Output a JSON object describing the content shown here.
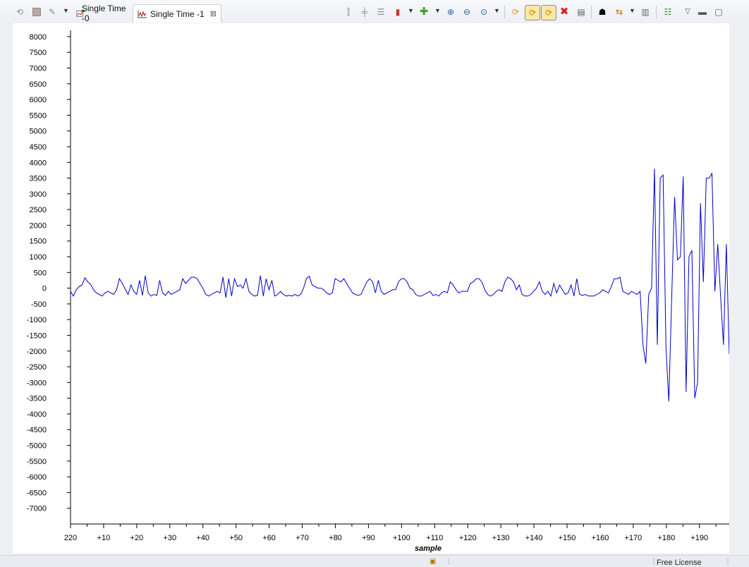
{
  "toolbar": {
    "left_icons": [
      "sync-icon",
      "stop-icon",
      "edit-icon"
    ],
    "right_icons": [
      "align-left-icon",
      "align-center-icon",
      "align-right-icon",
      "marker-icon",
      "add-icon",
      "zoom-in-icon",
      "zoom-out-icon",
      "zoom-fit-icon",
      "refresh-icon",
      "auto-scale-icon",
      "auto-scale-y-icon",
      "remove-icon",
      "export-icon",
      "find-icon",
      "settings-icon",
      "save-icon",
      "properties-icon",
      "view-menu-icon",
      "minimize-icon",
      "maximize-icon"
    ]
  },
  "tabs": [
    {
      "label": "Single Time -0",
      "icon": "graph-edit-icon",
      "active": false
    },
    {
      "label": "Single Time -1",
      "icon": "graph-icon",
      "active": true,
      "close": "⊠"
    }
  ],
  "status": {
    "license": "Free License"
  },
  "chart_data": {
    "type": "line",
    "title": "",
    "xlabel": "sample",
    "ylabel": "",
    "x_tick_labels": [
      "220",
      "+10",
      "+20",
      "+30",
      "+40",
      "+50",
      "+60",
      "+70",
      "+80",
      "+90",
      "+100",
      "+110",
      "+120",
      "+130",
      "+140",
      "+150",
      "+160",
      "+170",
      "+180",
      "+190"
    ],
    "y_tick_labels": [
      "8000",
      "7500",
      "7000",
      "6500",
      "6000",
      "5500",
      "5000",
      "4500",
      "4000",
      "3500",
      "3000",
      "2500",
      "2000",
      "1500",
      "1000",
      "500",
      "0",
      "-500",
      "-1000",
      "-1500",
      "-2000",
      "-2500",
      "-3000",
      "-3500",
      "-4000",
      "-4500",
      "-5000",
      "-5500",
      "-6000",
      "-6500",
      "-7000"
    ],
    "ylim": [
      -7500,
      8200
    ],
    "xlim": [
      0,
      199
    ],
    "grid": false,
    "series": [
      {
        "color": "#0000cc",
        "values": [
          -100,
          -250,
          -50,
          50,
          100,
          330,
          200,
          120,
          -50,
          -150,
          -200,
          -250,
          -150,
          -100,
          -150,
          -200,
          -50,
          300,
          150,
          -30,
          -200,
          100,
          -100,
          -200,
          250,
          -230,
          400,
          -150,
          -250,
          -200,
          -230,
          250,
          -150,
          -230,
          -100,
          -200,
          -150,
          -100,
          -50,
          300,
          150,
          250,
          350,
          350,
          300,
          150,
          0,
          -200,
          -250,
          -200,
          -150,
          -100,
          -150,
          350,
          -300,
          300,
          -250,
          300,
          50,
          100,
          0,
          300,
          -100,
          -200,
          -250,
          -230,
          400,
          -250,
          300,
          -50,
          250,
          -250,
          -200,
          -100,
          -200,
          -250,
          -230,
          -250,
          -200,
          -250,
          -200,
          0,
          300,
          380,
          100,
          50,
          0,
          0,
          -50,
          -150,
          -200,
          -150,
          300,
          250,
          200,
          300,
          150,
          0,
          -150,
          -200,
          -230,
          -200,
          0,
          200,
          300,
          200,
          -150,
          250,
          -100,
          -200,
          -150,
          -100,
          -50,
          -50,
          200,
          300,
          300,
          200,
          0,
          -50,
          -200,
          -250,
          -250,
          -200,
          -150,
          -100,
          -230,
          -200,
          -250,
          -150,
          -100,
          -150,
          200,
          100,
          -50,
          -150,
          -100,
          -100,
          -100,
          150,
          200,
          300,
          300,
          200,
          -50,
          -200,
          -250,
          -200,
          -100,
          -50,
          -100,
          200,
          350,
          300,
          200,
          -50,
          100,
          -200,
          -250,
          -250,
          -200,
          -100,
          0,
          200,
          -100,
          -200,
          -100,
          -250,
          150,
          -150,
          100,
          -50,
          -200,
          -150,
          100,
          -250,
          300,
          -200,
          -230,
          -200,
          -250,
          -250,
          -250,
          -200,
          -150,
          -50,
          -100,
          -150,
          50,
          300,
          300,
          350,
          -100,
          -150,
          -200,
          -100,
          -150,
          -200,
          -100,
          -1800,
          -2400,
          -200,
          0,
          3800,
          -1800,
          3500,
          3600,
          -1900,
          -3600,
          -300,
          2900,
          900,
          1000,
          3550,
          -3300,
          1000,
          1200,
          -3500,
          -3000,
          2700,
          200,
          3500,
          3500,
          3650,
          -100,
          1400,
          -300,
          -1800,
          1400,
          -2100
        ]
      }
    ]
  }
}
